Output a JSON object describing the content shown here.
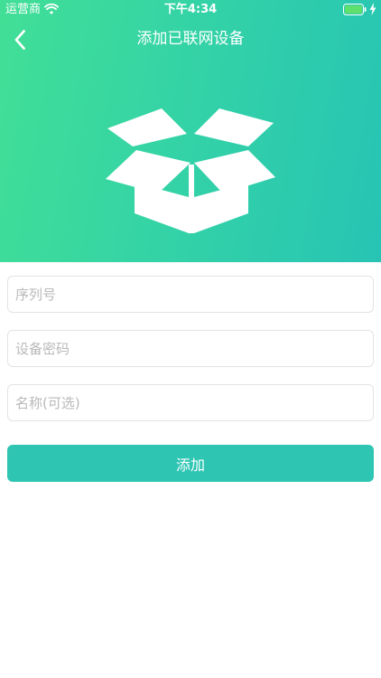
{
  "status_bar": {
    "carrier": "运营商",
    "time": "下午4:34"
  },
  "nav": {
    "title": "添加已联网设备",
    "back_icon": "chevron-left-icon"
  },
  "hero": {
    "illustration_icon": "open-box-icon"
  },
  "form": {
    "serial_placeholder": "序列号",
    "password_placeholder": "设备密码",
    "name_placeholder": "名称(可选)",
    "serial_value": "",
    "password_value": "",
    "name_value": ""
  },
  "actions": {
    "add_label": "添加"
  },
  "colors": {
    "gradient_start": "#41df96",
    "gradient_end": "#27c4b4",
    "button": "#2ec5b3",
    "placeholder": "#b9b9b9",
    "border": "#e3e3e3"
  }
}
